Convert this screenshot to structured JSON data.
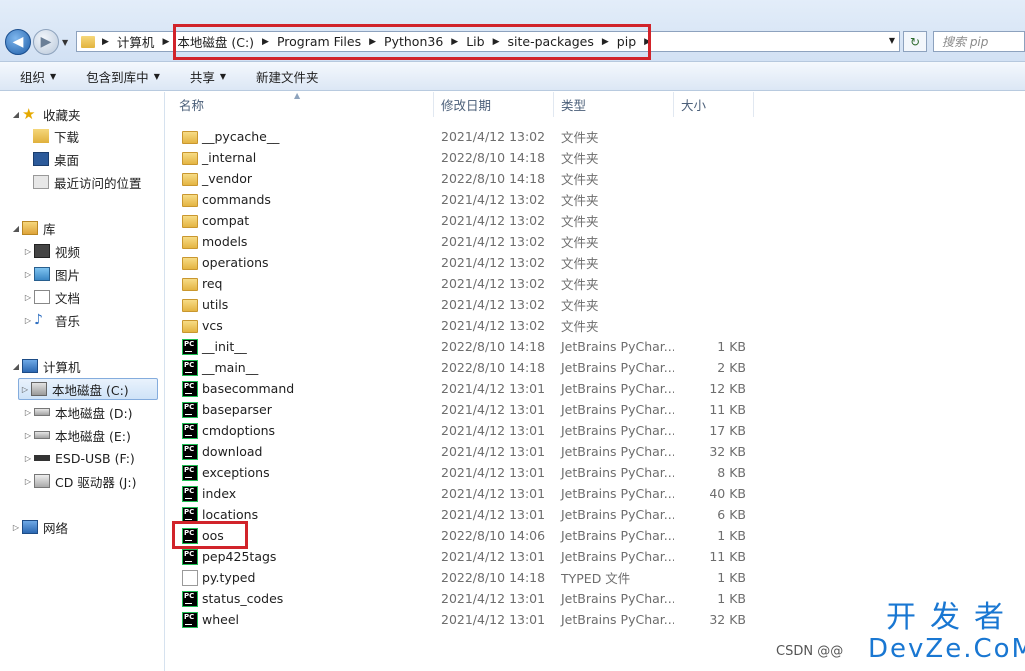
{
  "address": {
    "crumbs": [
      "计算机",
      "本地磁盘 (C:)",
      "Program Files",
      "Python36",
      "Lib",
      "site-packages",
      "pip"
    ],
    "search_placeholder": "搜索 pip"
  },
  "toolbar": {
    "items": [
      "组织",
      "包含到库中",
      "共享",
      "新建文件夹"
    ]
  },
  "nav": {
    "favorites": "收藏夹",
    "downloads": "下载",
    "desktop": "桌面",
    "recent": "最近访问的位置",
    "libraries": "库",
    "videos": "视频",
    "pictures": "图片",
    "documents": "文档",
    "music": "音乐",
    "computer": "计算机",
    "drive_c": "本地磁盘 (C:)",
    "drive_d": "本地磁盘 (D:)",
    "drive_e": "本地磁盘 (E:)",
    "drive_f": "ESD-USB (F:)",
    "drive_j": "CD 驱动器 (J:)",
    "network": "网络"
  },
  "columns": {
    "name": "名称",
    "date": "修改日期",
    "type": "类型",
    "size": "大小"
  },
  "files": [
    {
      "name": "__pycache__",
      "date": "2021/4/12 13:02",
      "type": "文件夹",
      "size": "",
      "icon": "folder-icon"
    },
    {
      "name": "_internal",
      "date": "2022/8/10 14:18",
      "type": "文件夹",
      "size": "",
      "icon": "folder-icon"
    },
    {
      "name": "_vendor",
      "date": "2022/8/10 14:18",
      "type": "文件夹",
      "size": "",
      "icon": "folder-icon"
    },
    {
      "name": "commands",
      "date": "2021/4/12 13:02",
      "type": "文件夹",
      "size": "",
      "icon": "folder-icon"
    },
    {
      "name": "compat",
      "date": "2021/4/12 13:02",
      "type": "文件夹",
      "size": "",
      "icon": "folder-icon"
    },
    {
      "name": "models",
      "date": "2021/4/12 13:02",
      "type": "文件夹",
      "size": "",
      "icon": "folder-icon"
    },
    {
      "name": "operations",
      "date": "2021/4/12 13:02",
      "type": "文件夹",
      "size": "",
      "icon": "folder-icon"
    },
    {
      "name": "req",
      "date": "2021/4/12 13:02",
      "type": "文件夹",
      "size": "",
      "icon": "folder-icon"
    },
    {
      "name": "utils",
      "date": "2021/4/12 13:02",
      "type": "文件夹",
      "size": "",
      "icon": "folder-icon"
    },
    {
      "name": "vcs",
      "date": "2021/4/12 13:02",
      "type": "文件夹",
      "size": "",
      "icon": "folder-icon"
    },
    {
      "name": "__init__",
      "date": "2022/8/10 14:18",
      "type": "JetBrains PyChar...",
      "size": "1 KB",
      "icon": "pycharm-file-icon"
    },
    {
      "name": "__main__",
      "date": "2022/8/10 14:18",
      "type": "JetBrains PyChar...",
      "size": "2 KB",
      "icon": "pycharm-file-icon"
    },
    {
      "name": "basecommand",
      "date": "2021/4/12 13:01",
      "type": "JetBrains PyChar...",
      "size": "12 KB",
      "icon": "pycharm-file-icon"
    },
    {
      "name": "baseparser",
      "date": "2021/4/12 13:01",
      "type": "JetBrains PyChar...",
      "size": "11 KB",
      "icon": "pycharm-file-icon"
    },
    {
      "name": "cmdoptions",
      "date": "2021/4/12 13:01",
      "type": "JetBrains PyChar...",
      "size": "17 KB",
      "icon": "pycharm-file-icon"
    },
    {
      "name": "download",
      "date": "2021/4/12 13:01",
      "type": "JetBrains PyChar...",
      "size": "32 KB",
      "icon": "pycharm-file-icon"
    },
    {
      "name": "exceptions",
      "date": "2021/4/12 13:01",
      "type": "JetBrains PyChar...",
      "size": "8 KB",
      "icon": "pycharm-file-icon"
    },
    {
      "name": "index",
      "date": "2021/4/12 13:01",
      "type": "JetBrains PyChar...",
      "size": "40 KB",
      "icon": "pycharm-file-icon"
    },
    {
      "name": "locations",
      "date": "2021/4/12 13:01",
      "type": "JetBrains PyChar...",
      "size": "6 KB",
      "icon": "pycharm-file-icon"
    },
    {
      "name": "oos",
      "date": "2022/8/10 14:06",
      "type": "JetBrains PyChar...",
      "size": "1 KB",
      "icon": "pycharm-file-icon"
    },
    {
      "name": "pep425tags",
      "date": "2021/4/12 13:01",
      "type": "JetBrains PyChar...",
      "size": "11 KB",
      "icon": "pycharm-file-icon"
    },
    {
      "name": "py.typed",
      "date": "2022/8/10 14:18",
      "type": "TYPED 文件",
      "size": "1 KB",
      "icon": "blank-file-icon"
    },
    {
      "name": "status_codes",
      "date": "2021/4/12 13:01",
      "type": "JetBrains PyChar...",
      "size": "1 KB",
      "icon": "pycharm-file-icon"
    },
    {
      "name": "wheel",
      "date": "2021/4/12 13:01",
      "type": "JetBrains PyChar...",
      "size": "32 KB",
      "icon": "pycharm-file-icon"
    }
  ],
  "watermark": {
    "csdn": "CSDN @@",
    "kfz_top": "开发者",
    "kfz_bottom": "DevZe.CoM"
  },
  "colors": {
    "highlight": "#d1232a",
    "accent": "#1977d2"
  }
}
